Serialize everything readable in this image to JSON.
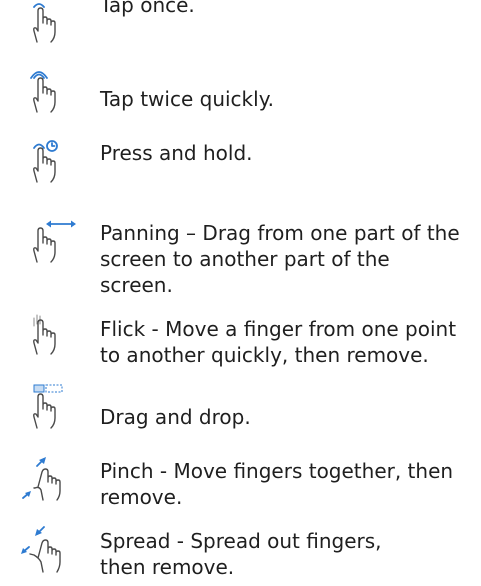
{
  "gestures": [
    {
      "id": "tap",
      "icon": "tap-hand-icon",
      "text": "Tap once."
    },
    {
      "id": "double-tap",
      "icon": "double-tap-hand-icon",
      "text": "Tap twice quickly."
    },
    {
      "id": "press-hold",
      "icon": "press-and-hold-hand-icon",
      "text": "Press and hold."
    },
    {
      "id": "pan",
      "icon": "pan-hand-icon",
      "text": "Panning – Drag from one part of the screen to another part of the screen."
    },
    {
      "id": "flick",
      "icon": "flick-hand-icon",
      "text": "Flick - Move a finger from one point to another quickly, then remove."
    },
    {
      "id": "drag-drop",
      "icon": "drag-and-drop-hand-icon",
      "text": "Drag and drop."
    },
    {
      "id": "pinch",
      "icon": "pinch-hand-icon",
      "text": "Pinch - Move fingers together, then remove."
    },
    {
      "id": "spread",
      "icon": "spread-hand-icon",
      "text": "Spread - Spread out fingers, then remove."
    }
  ],
  "colors": {
    "accent": "#2e7bd1",
    "hand_outline": "#4a4a4a",
    "text": "#1f1f1f"
  }
}
